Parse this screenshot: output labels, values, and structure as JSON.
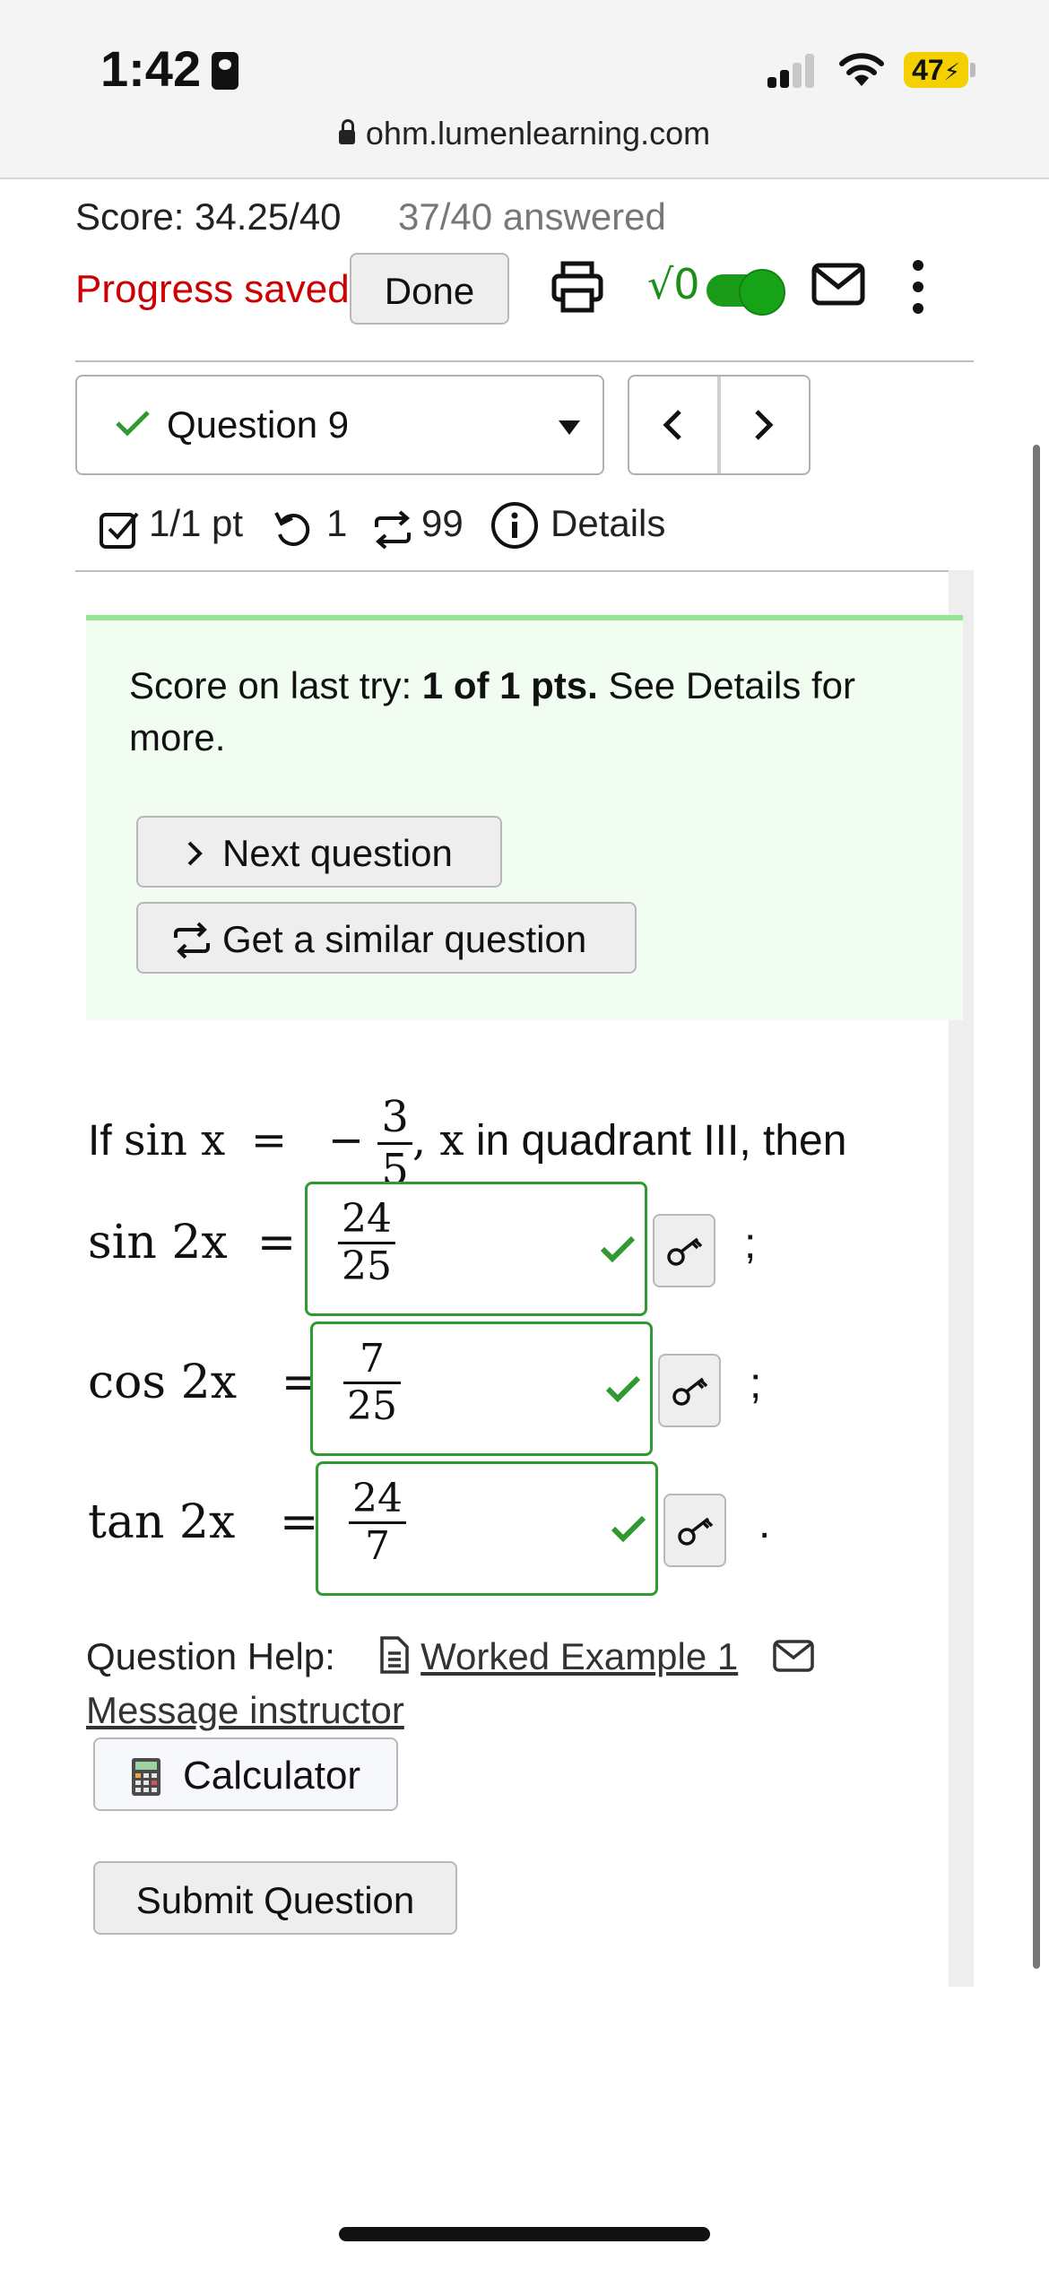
{
  "status": {
    "time": "1:42",
    "battery": "47"
  },
  "browser": {
    "url": "ohm.lumenlearning.com"
  },
  "header": {
    "score": "Score: 34.25/40",
    "answered": "37/40 answered",
    "progress": "Progress saved",
    "done_label": "Done"
  },
  "question_nav": {
    "selected": "Question 9",
    "points": "1/1 pt",
    "retries": "1",
    "regens": "99",
    "details": "Details"
  },
  "feedback": {
    "prefix": "Score on last try: ",
    "score_bold": "1 of 1 pts.",
    "suffix": " See Details for more.",
    "next_label": "Next question",
    "similar_label": "Get a similar question"
  },
  "problem": {
    "intro": "If",
    "given_fn": "sin x",
    "given_num": "3",
    "given_den": "5",
    "condition": "x",
    "tail": "in quadrant III, then"
  },
  "answers": [
    {
      "label": "sin 2x",
      "num": "24",
      "den": "25",
      "status": "correct",
      "punct": ";"
    },
    {
      "label": "cos 2x",
      "num": "7",
      "den": "25",
      "status": "correct",
      "punct": ";"
    },
    {
      "label": "tan 2x",
      "num": "24",
      "den": "7",
      "status": "correct",
      "punct": "."
    }
  ],
  "help": {
    "label": "Question Help:",
    "worked_example": "Worked Example 1",
    "message": "Message instructor",
    "calculator": "Calculator"
  },
  "submit_label": "Submit Question",
  "colors": {
    "correct": "#2f9a2f",
    "saved": "#cc0000",
    "feedback_bg": "#f0fdf0"
  }
}
